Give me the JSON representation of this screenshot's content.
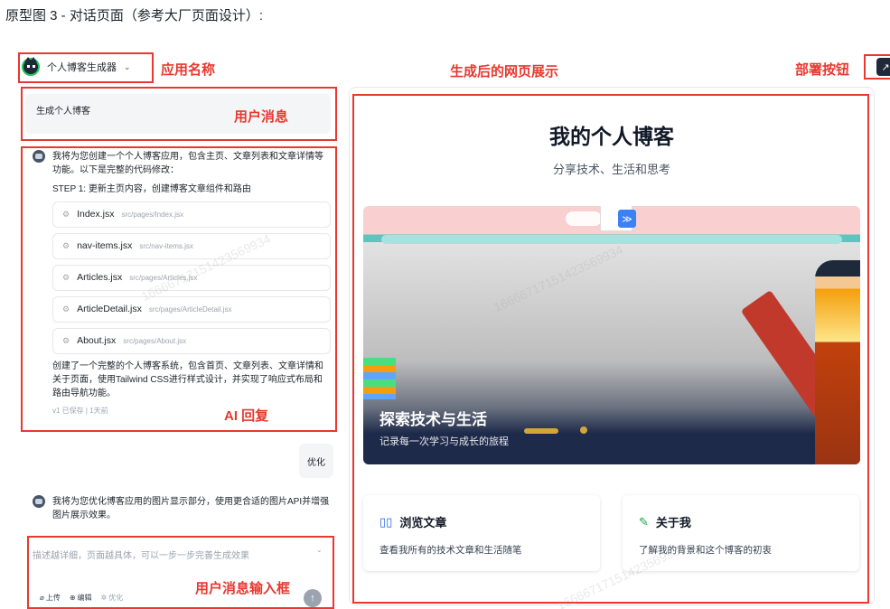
{
  "caption": "原型图 3 - 对话页面（参考大厂页面设计）:",
  "header": {
    "app_name": "个人博客生成器",
    "chevron": "⌄"
  },
  "annotations": {
    "app_name": "应用名称",
    "preview": "生成后的网页展示",
    "deploy": "部署按钮",
    "user_message": "用户消息",
    "ai_reply": "AI 回复",
    "input_box": "用户消息输入框"
  },
  "chat": {
    "user_message": "生成个人博客",
    "ai_intro": "我将为您创建一个个人博客应用，包含主页、文章列表和文章详情等功能。以下是完整的代码修改：",
    "step": "STEP 1: 更新主页内容，创建博客文章组件和路由",
    "files": [
      {
        "name": "Index.jsx",
        "path": "src/pages/Index.jsx"
      },
      {
        "name": "nav-items.jsx",
        "path": "src/nav-items.jsx"
      },
      {
        "name": "Articles.jsx",
        "path": "src/pages/Articles.jsx"
      },
      {
        "name": "ArticleDetail.jsx",
        "path": "src/pages/ArticleDetail.jsx"
      },
      {
        "name": "About.jsx",
        "path": "src/pages/About.jsx"
      }
    ],
    "ai_summary": "创建了一个完整的个人博客系统，包含首页、文章列表、文章详情和关于页面，使用Tailwind CSS进行样式设计，并实现了响应式布局和路由导航功能。",
    "ai_meta": "v1 已保存 | 1天前",
    "optimize_message": "优化",
    "ai_reply2": "我将为您优化博客应用的图片显示部分，使用更合适的图片API并增强图片展示效果。"
  },
  "input": {
    "placeholder": "描述越详细，页面越具体，可以一步一步完善生成效果",
    "upload_label": "上传",
    "edit_label": "编辑",
    "optimize_label": "优化",
    "send_icon": "↑"
  },
  "preview": {
    "title": "我的个人博客",
    "subtitle": "分享技术、生活和思考",
    "hero_title": "探索技术与生活",
    "hero_subtitle": "记录每一次学习与成长的旅程",
    "cards": [
      {
        "icon": "📖",
        "title": "浏览文章",
        "desc": "查看我所有的技术文章和生活随笔",
        "color": "#2563eb"
      },
      {
        "icon": "✎",
        "title": "关于我",
        "desc": "了解我的背景和这个博客的初衷",
        "color": "#16a34a"
      }
    ]
  },
  "watermark": "16666717151423569934"
}
